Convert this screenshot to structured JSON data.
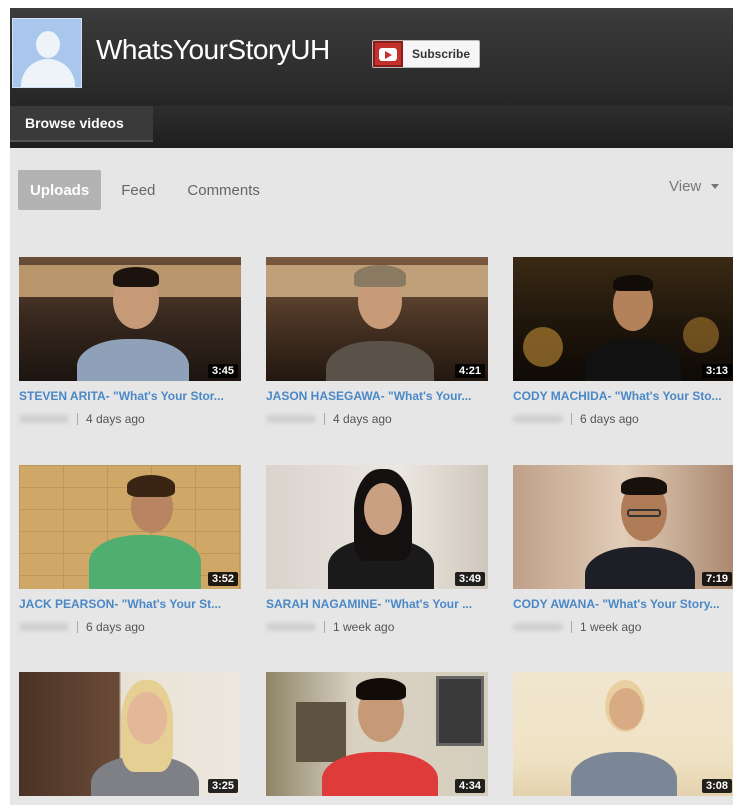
{
  "channel": {
    "name": "WhatsYourStoryUH",
    "subscribe_label": "Subscribe"
  },
  "nav": {
    "browse_label": "Browse videos"
  },
  "tabs": [
    {
      "label": "Uploads",
      "active": true
    },
    {
      "label": "Feed",
      "active": false
    },
    {
      "label": "Comments",
      "active": false
    }
  ],
  "view_menu": {
    "label": "View"
  },
  "videos": [
    {
      "title": "STEVEN ARITA- \"What's Your Stor...",
      "age": "4 days ago",
      "duration": "3:45",
      "icon": "thumbnail-person"
    },
    {
      "title": "JASON HASEGAWA- \"What's Your...",
      "age": "4 days ago",
      "duration": "4:21",
      "icon": "thumbnail-person"
    },
    {
      "title": "CODY MACHIDA- \"What's Your Sto...",
      "age": "6 days ago",
      "duration": "3:13",
      "icon": "thumbnail-person"
    },
    {
      "title": "JACK PEARSON- \"What's Your St...",
      "age": "6 days ago",
      "duration": "3:52",
      "icon": "thumbnail-person"
    },
    {
      "title": "SARAH NAGAMINE- \"What's Your ...",
      "age": "1 week ago",
      "duration": "3:49",
      "icon": "thumbnail-person"
    },
    {
      "title": "CODY AWANA- \"What's Your Story...",
      "age": "1 week ago",
      "duration": "7:19",
      "icon": "thumbnail-person"
    },
    {
      "title": "",
      "age": "",
      "duration": "3:25",
      "icon": "thumbnail-person"
    },
    {
      "title": "",
      "age": "",
      "duration": "4:34",
      "icon": "thumbnail-person"
    },
    {
      "title": "",
      "age": "",
      "duration": "3:08",
      "icon": "thumbnail-person"
    }
  ],
  "colors": {
    "link": "#4a88c6",
    "header_bg": "#2e2e2e",
    "page_bg": "#e6e6e6",
    "subscribe_red": "#c4302b"
  }
}
